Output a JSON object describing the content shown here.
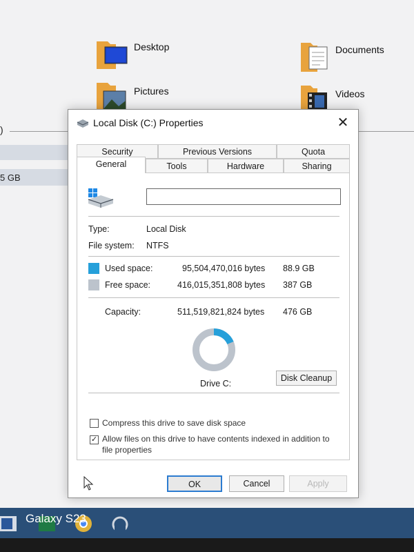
{
  "explorer": {
    "folders": [
      {
        "name": "Desktop"
      },
      {
        "name": "Documents"
      },
      {
        "name": "Pictures"
      },
      {
        "name": "Videos"
      }
    ],
    "left_partial": ")",
    "left_size": "5 GB"
  },
  "dialog": {
    "title": "Local Disk (C:) Properties",
    "close_symbol": "✕",
    "tabs_top": [
      "Security",
      "Previous Versions",
      "Quota"
    ],
    "tabs_bottom": [
      "General",
      "Tools",
      "Hardware",
      "Sharing"
    ],
    "active_tab": "General",
    "drive_name_value": "",
    "type_label": "Type:",
    "type_value": "Local Disk",
    "fs_label": "File system:",
    "fs_value": "NTFS",
    "used_label": "Used space:",
    "used_bytes": "95,504,470,016 bytes",
    "used_gb": "88.9 GB",
    "free_label": "Free space:",
    "free_bytes": "416,015,351,808 bytes",
    "free_gb": "387 GB",
    "capacity_label": "Capacity:",
    "capacity_bytes": "511,519,821,824 bytes",
    "capacity_gb": "476 GB",
    "used_fraction": 0.187,
    "drive_label": "Drive C:",
    "cleanup_button": "Disk Cleanup",
    "compress_label": "Compress this drive to save disk space",
    "compress_checked": false,
    "index_label_line1": "Allow files on this drive to have contents indexed in addition to",
    "index_label_line2": "file properties",
    "index_checked": true,
    "check_mark": "✓",
    "ok_button": "OK",
    "cancel_button": "Cancel",
    "apply_button": "Apply"
  },
  "colors": {
    "used": "#26a0da",
    "free": "#bcc3cc",
    "accent": "#2b7bd0",
    "taskbar": "#2a4f78"
  },
  "watermark": "Galaxy S23"
}
